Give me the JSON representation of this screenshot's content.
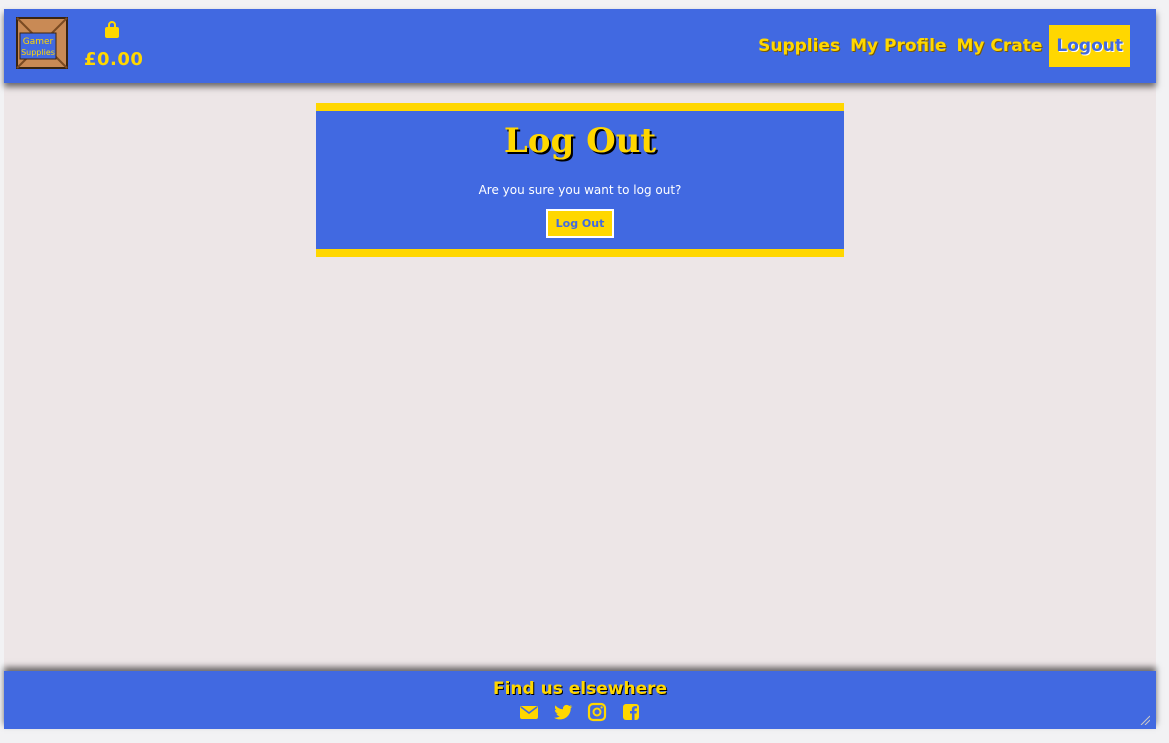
{
  "header": {
    "logo_text_line1": "Gamer",
    "logo_text_line2": "Supplies",
    "cart_icon": "shopping-bag-icon",
    "cart_total": "£0.00",
    "nav": [
      {
        "label": "Supplies",
        "active": false
      },
      {
        "label": "My Profile",
        "active": false
      },
      {
        "label": "My Crate",
        "active": false
      },
      {
        "label": "Logout",
        "active": true
      }
    ]
  },
  "main": {
    "title": "Log Out",
    "message": "Are you sure you want to log out?",
    "button_label": "Log Out"
  },
  "footer": {
    "title": "Find us elsewhere",
    "socials": [
      "envelope-icon",
      "twitter-icon",
      "instagram-icon",
      "facebook-icon"
    ]
  },
  "colors": {
    "primary": "#4169e1",
    "accent": "#ffd700",
    "background": "#ede6e7"
  }
}
